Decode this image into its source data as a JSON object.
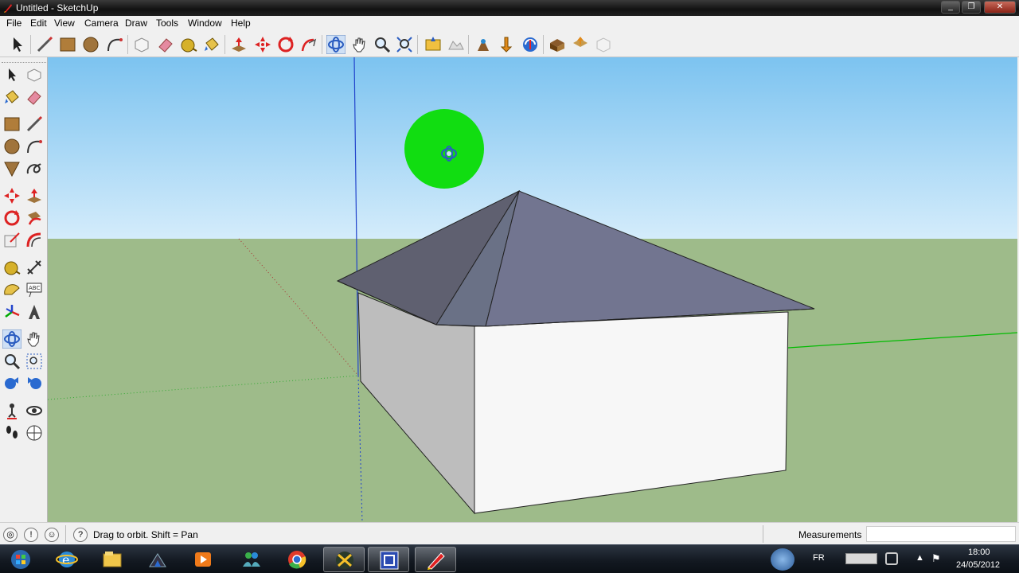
{
  "window": {
    "title": "Untitled - SketchUp",
    "controls": [
      "minimize",
      "maximize",
      "close"
    ]
  },
  "menu": [
    "File",
    "Edit",
    "View",
    "Camera",
    "Draw",
    "Tools",
    "Window",
    "Help"
  ],
  "toolbar": {
    "tools": [
      "select",
      "line",
      "rectangle",
      "circle",
      "arc",
      "make-component",
      "eraser",
      "tape-measure",
      "paint-bucket",
      "push-pull",
      "move",
      "rotate",
      "follow-me",
      "orbit",
      "pan",
      "zoom",
      "zoom-extents",
      "previous-view",
      "next-view",
      "add-location",
      "toggle-terrain",
      "preview-google-earth",
      "get-models",
      "share-model",
      "share-component"
    ]
  },
  "sidebar": {
    "tools": [
      "select",
      "make-component",
      "paint-bucket",
      "eraser",
      "rectangle",
      "line",
      "circle",
      "arc",
      "polygon",
      "freehand",
      "move",
      "push-pull",
      "rotate",
      "follow-me",
      "scale",
      "offset",
      "tape-measure",
      "dimensions",
      "protractor",
      "text",
      "axes",
      "3d-text",
      "orbit",
      "pan",
      "zoom",
      "zoom-window",
      "previous-view",
      "zoom-extents",
      "position-camera",
      "look-around",
      "walk",
      "section-plane"
    ]
  },
  "status": {
    "hint": "Drag to orbit.  Shift = Pan",
    "measurements_label": "Measurements",
    "measurements_value": ""
  },
  "taskbar": {
    "apps": [
      "start",
      "internet-explorer",
      "file-explorer",
      "app-3",
      "media-player",
      "messenger",
      "chrome",
      "app-7",
      "app-8",
      "sketchup"
    ],
    "language": "FR",
    "time": "18:00",
    "date": "24/05/2012"
  },
  "colors": {
    "sky_top": "#7cc3f0",
    "sky_bottom": "#d4ecfb",
    "ground": "#9ebb8a",
    "roof": "#6f7188",
    "wall_front": "#f7f7f7",
    "wall_side": "#bdbdbd",
    "orbit_cursor": "#11dd11",
    "axis_blue": "#2244cc",
    "axis_green": "#00bb00"
  }
}
